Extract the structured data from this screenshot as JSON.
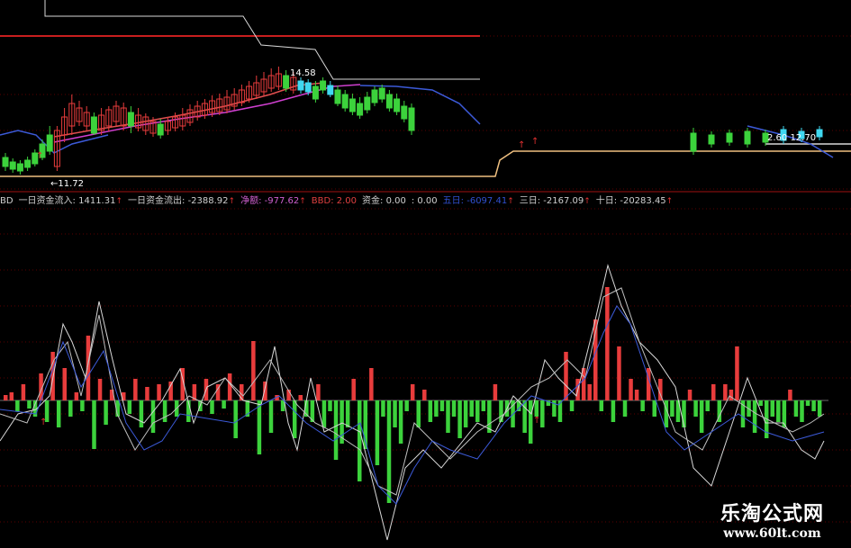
{
  "colors": {
    "background": "#000000",
    "up_candle": "#e83c3c",
    "down_candle": "#3cd23c",
    "ma_magenta": "#d040d0",
    "ma_red": "#e05050",
    "ma_blue": "#3c5ad8",
    "highlight_cyan": "#40d8f0",
    "white_line": "#d8d8d8",
    "level_line_red": "#c81e1e",
    "orange_line": "#f0c080",
    "grid_red": "#5a0000"
  },
  "price_panel": {
    "high_label": "14.58",
    "low_label": "←11.72",
    "right_label": "2.60 12.70"
  },
  "indicator_bar": {
    "items": [
      {
        "label": "BD",
        "value": "",
        "color": "#cfcfcf"
      },
      {
        "label": "一日资金流入:",
        "value": "1411.31",
        "color": "#cfcfcf",
        "arrow": "↑"
      },
      {
        "label": "一日资金流出:",
        "value": "-2388.92",
        "color": "#cfcfcf",
        "arrow": "↑"
      },
      {
        "label": "净额:",
        "value": "-977.62",
        "color": "#d060d0",
        "arrow": "↑"
      },
      {
        "label": "BBD:",
        "value": "2.00",
        "color": "#e04040",
        "arrow": ""
      },
      {
        "label": "资金:",
        "value": "0.00",
        "color": "#cfcfcf",
        "arrow": ""
      },
      {
        "label": ":",
        "value": "0.00",
        "color": "#cfcfcf",
        "arrow": ""
      },
      {
        "label": "五日:",
        "value": "-6097.41",
        "color": "#3050d0",
        "arrow": "↑"
      },
      {
        "label": "三日:",
        "value": "-2167.09",
        "color": "#cfcfcf",
        "arrow": "↑"
      },
      {
        "label": "十日:",
        "value": "-20283.45",
        "color": "#cfcfcf",
        "arrow": "↑"
      }
    ]
  },
  "chart_data": {
    "type": "bar",
    "candles": [
      [
        175,
        185,
        170,
        190,
        "d"
      ],
      [
        180,
        188,
        176,
        192,
        "d"
      ],
      [
        182,
        190,
        178,
        194,
        "d"
      ],
      [
        178,
        186,
        174,
        190,
        "d"
      ],
      [
        170,
        182,
        166,
        185,
        "d"
      ],
      [
        160,
        175,
        155,
        178,
        "d"
      ],
      [
        150,
        168,
        140,
        172,
        "d"
      ],
      [
        145,
        185,
        140,
        190,
        "u"
      ],
      [
        130,
        150,
        120,
        158,
        "u"
      ],
      [
        115,
        140,
        105,
        150,
        "u"
      ],
      [
        120,
        135,
        112,
        140,
        "u"
      ],
      [
        125,
        140,
        118,
        146,
        "u"
      ],
      [
        130,
        148,
        125,
        150,
        "d"
      ],
      [
        128,
        145,
        120,
        150,
        "u"
      ],
      [
        122,
        140,
        118,
        146,
        "u"
      ],
      [
        118,
        135,
        112,
        140,
        "u"
      ],
      [
        120,
        140,
        114,
        145,
        "u"
      ],
      [
        125,
        140,
        118,
        148,
        "d"
      ],
      [
        128,
        142,
        120,
        146,
        "u"
      ],
      [
        130,
        145,
        126,
        150,
        "u"
      ],
      [
        135,
        148,
        130,
        152,
        "u"
      ],
      [
        138,
        150,
        132,
        154,
        "d"
      ],
      [
        135,
        145,
        130,
        150,
        "u"
      ],
      [
        130,
        142,
        125,
        146,
        "u"
      ],
      [
        128,
        140,
        120,
        145,
        "u"
      ],
      [
        122,
        136,
        116,
        140,
        "u"
      ],
      [
        118,
        130,
        112,
        134,
        "u"
      ],
      [
        115,
        128,
        110,
        132,
        "u"
      ],
      [
        112,
        125,
        106,
        130,
        "u"
      ],
      [
        110,
        124,
        104,
        128,
        "u"
      ],
      [
        108,
        122,
        100,
        126,
        "u"
      ],
      [
        105,
        118,
        98,
        122,
        "u"
      ],
      [
        100,
        114,
        94,
        118,
        "u"
      ],
      [
        96,
        110,
        90,
        114,
        "u"
      ],
      [
        92,
        106,
        84,
        110,
        "u"
      ],
      [
        88,
        102,
        80,
        106,
        "u"
      ],
      [
        84,
        98,
        76,
        102,
        "u"
      ],
      [
        82,
        96,
        74,
        100,
        "u"
      ],
      [
        84,
        98,
        78,
        102,
        "d"
      ],
      [
        86,
        100,
        80,
        104,
        "u"
      ],
      [
        90,
        100,
        86,
        104,
        "c"
      ],
      [
        92,
        102,
        88,
        106,
        "c"
      ],
      [
        96,
        110,
        90,
        114,
        "d"
      ],
      [
        90,
        100,
        86,
        104,
        "d"
      ],
      [
        95,
        105,
        90,
        108,
        "c"
      ],
      [
        100,
        115,
        95,
        118,
        "d"
      ],
      [
        105,
        120,
        100,
        124,
        "d"
      ],
      [
        110,
        124,
        104,
        128,
        "d"
      ],
      [
        115,
        128,
        108,
        132,
        "d"
      ],
      [
        108,
        122,
        102,
        126,
        "d"
      ],
      [
        100,
        114,
        96,
        118,
        "d"
      ],
      [
        98,
        110,
        94,
        114,
        "d"
      ],
      [
        105,
        120,
        100,
        124,
        "d"
      ],
      [
        110,
        124,
        104,
        128,
        "d"
      ],
      [
        118,
        132,
        112,
        136,
        "d"
      ],
      [
        120,
        145,
        115,
        150,
        "d"
      ],
      [
        148,
        168,
        142,
        172,
        "d"
      ],
      [
        150,
        160,
        146,
        164,
        "d"
      ],
      [
        148,
        158,
        144,
        162,
        "d"
      ],
      [
        146,
        160,
        142,
        164,
        "d"
      ],
      [
        148,
        158,
        144,
        162,
        "d"
      ],
      [
        144,
        156,
        140,
        160,
        "c"
      ],
      [
        146,
        154,
        142,
        158,
        "c"
      ],
      [
        144,
        152,
        140,
        156,
        "c"
      ]
    ],
    "hist_values": [
      2,
      3,
      -4,
      6,
      -3,
      -6,
      10,
      -8,
      18,
      -10,
      12,
      -6,
      3,
      -4,
      24,
      -18,
      8,
      -9,
      4,
      -6,
      3,
      -5,
      8,
      -10,
      5,
      -12,
      6,
      -8,
      7,
      -6,
      12,
      -8,
      6,
      -4,
      8,
      -5,
      6,
      -3,
      10,
      -14,
      6,
      -6,
      22,
      -20,
      7,
      -12,
      2,
      -4,
      4,
      -14,
      2,
      -6,
      -8,
      6,
      -10,
      -4,
      -22,
      -16,
      -10,
      8,
      -30,
      -18,
      12,
      -24,
      -6,
      -38,
      -10,
      -16,
      -4,
      6,
      -10,
      4,
      -8,
      -6,
      -4,
      -12,
      -6,
      -14,
      -10,
      -6,
      -8,
      -4,
      -12,
      6,
      -8,
      -6,
      -10,
      -4,
      -12,
      -16,
      -6,
      -10,
      -2,
      -6,
      -8,
      18,
      -4,
      8,
      12,
      6,
      30,
      -4,
      42,
      -8,
      20,
      -6,
      8,
      4,
      -4,
      12,
      -6,
      8,
      -10,
      -6,
      -8,
      -10,
      4,
      -6,
      -12,
      -4,
      6,
      -8,
      6,
      4,
      20,
      -10,
      -6,
      -12,
      -2,
      -14,
      -6,
      -8,
      -10,
      4,
      -6,
      -8,
      -2,
      -4,
      -6
    ],
    "x_ticks": [],
    "series": []
  },
  "watermark": {
    "title": "乐淘公式网",
    "url": "www.60lt.com"
  }
}
